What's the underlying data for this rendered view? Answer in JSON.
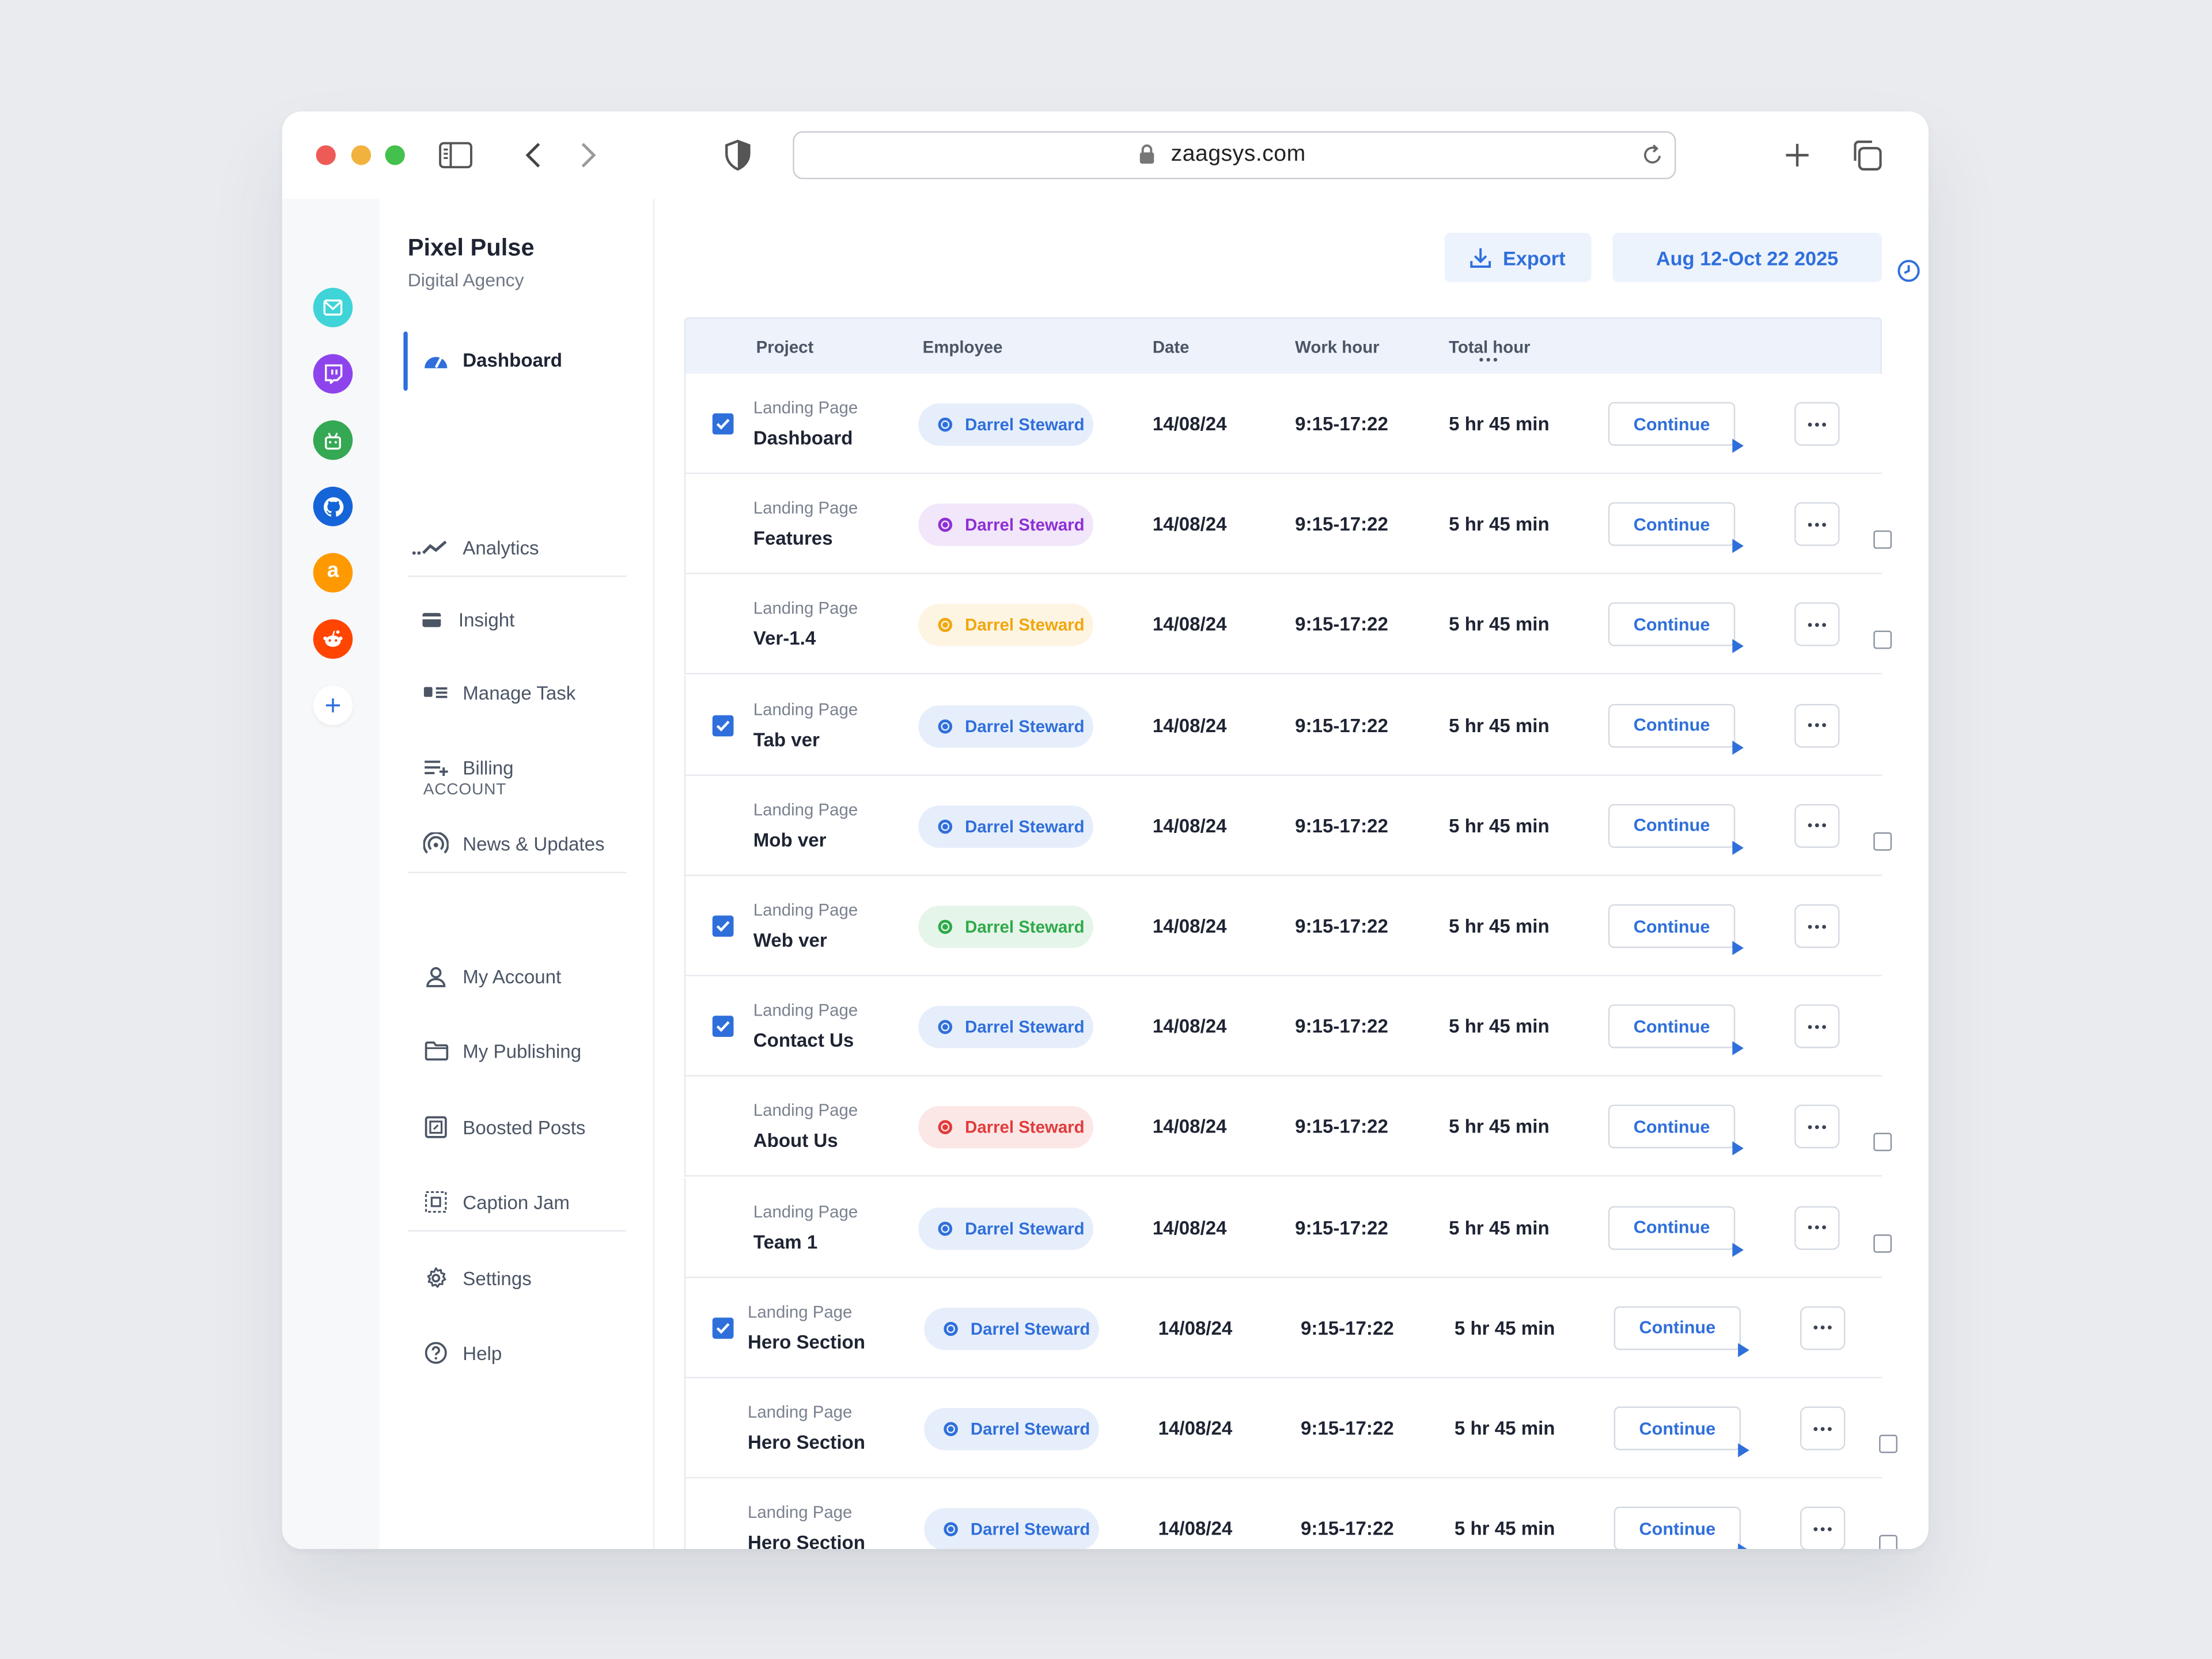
{
  "browser": {
    "url": "zaagsys.com"
  },
  "brand": {
    "name": "Pixel Pulse",
    "subtitle": "Digital Agency"
  },
  "nav": [
    {
      "label": "Dashboard",
      "icon": "dashboard-gauge-icon",
      "active": true
    },
    {
      "label": "Analytics",
      "icon": "analytics-line-icon"
    },
    {
      "label": "Insight",
      "icon": "card-icon"
    },
    {
      "label": "Manage Task",
      "icon": "task-list-icon"
    },
    {
      "label": "Billing",
      "icon": "billing-list-add-icon"
    },
    {
      "label": "News & Updates",
      "icon": "broadcast-icon"
    }
  ],
  "account_section": "ACCOUNT",
  "account_nav": [
    {
      "label": "My Account",
      "icon": "user-icon"
    },
    {
      "label": "My Publishing",
      "icon": "folder-icon"
    },
    {
      "label": "Boosted Posts",
      "icon": "boost-icon"
    },
    {
      "label": "Caption Jam",
      "icon": "caption-frame-icon"
    },
    {
      "label": "Settings",
      "icon": "gear-icon"
    },
    {
      "label": "Help",
      "icon": "help-circle-icon"
    }
  ],
  "rail_apps": [
    {
      "name": "mail-app-icon",
      "color": "#3fd4d8"
    },
    {
      "name": "twitch-icon",
      "color": "#8e44ec"
    },
    {
      "name": "android-icon",
      "color": "#34a853"
    },
    {
      "name": "github-icon",
      "color": "#1565d8"
    },
    {
      "name": "amazon-icon",
      "color": "#ff9900",
      "glyph": "a"
    },
    {
      "name": "reddit-icon",
      "color": "#ff4500"
    }
  ],
  "toolbar": {
    "export_label": "Export",
    "date_range": "Aug 12-Oct 22 2025"
  },
  "table": {
    "headers": {
      "project": "Project",
      "employee": "Employee",
      "date": "Date",
      "work_hour": "Work hour",
      "total_hour": "Total hour"
    },
    "rows": [
      {
        "subtitle": "Landing Page",
        "title": "Dashboard",
        "employee": "Darrel Steward",
        "status_color": "#2f6fdb",
        "date": "14/08/24",
        "work_hour": "9:15-17:22",
        "total": "5 hr 45 min",
        "action": "Continue",
        "checked": true
      },
      {
        "subtitle": "Landing Page",
        "title": "Features",
        "employee": "Darrel Steward",
        "status_color": "#8e2fd6",
        "date": "14/08/24",
        "work_hour": "9:15-17:22",
        "total": "5 hr 45 min",
        "action": "Continue",
        "checked": false
      },
      {
        "subtitle": "Landing Page",
        "title": "Ver-1.4",
        "employee": "Darrel Steward",
        "status_color": "#f0a70e",
        "date": "14/08/24",
        "work_hour": "9:15-17:22",
        "total": "5 hr 45 min",
        "action": "Continue",
        "checked": false
      },
      {
        "subtitle": "Landing Page",
        "title": "Tab ver",
        "employee": "Darrel Steward",
        "status_color": "#2f6fdb",
        "date": "14/08/24",
        "work_hour": "9:15-17:22",
        "total": "5 hr 45 min",
        "action": "Continue",
        "checked": true
      },
      {
        "subtitle": "Landing Page",
        "title": "Mob ver",
        "employee": "Darrel Steward",
        "status_color": "#2f6fdb",
        "date": "14/08/24",
        "work_hour": "9:15-17:22",
        "total": "5 hr 45 min",
        "action": "Continue",
        "checked": false
      },
      {
        "subtitle": "Landing Page",
        "title": "Web ver",
        "employee": "Darrel Steward",
        "status_color": "#2eaa4a",
        "date": "14/08/24",
        "work_hour": "9:15-17:22",
        "total": "5 hr 45 min",
        "action": "Continue",
        "checked": true
      },
      {
        "subtitle": "Landing Page",
        "title": "Contact Us",
        "employee": "Darrel Steward",
        "status_color": "#2f6fdb",
        "date": "14/08/24",
        "work_hour": "9:15-17:22",
        "total": "5 hr 45 min",
        "action": "Continue",
        "checked": true
      },
      {
        "subtitle": "Landing Page",
        "title": "About Us",
        "employee": "Darrel Steward",
        "status_color": "#e23b3b",
        "date": "14/08/24",
        "work_hour": "9:15-17:22",
        "total": "5 hr 45 min",
        "action": "Continue",
        "checked": false
      },
      {
        "subtitle": "Landing Page",
        "title": "Team 1",
        "employee": "Darrel Steward",
        "status_color": "#2f6fdb",
        "date": "14/08/24",
        "work_hour": "9:15-17:22",
        "total": "5 hr 45 min",
        "action": "Continue",
        "checked": false
      },
      {
        "subtitle": "Landing Page",
        "title": "Hero Section",
        "employee": "Darrel Steward",
        "status_color": "#2f6fdb",
        "date": "14/08/24",
        "work_hour": "9:15-17:22",
        "total": "5 hr 45 min",
        "action": "Continue",
        "checked": true
      },
      {
        "subtitle": "Landing Page",
        "title": "Hero Section",
        "employee": "Darrel Steward",
        "status_color": "#2f6fdb",
        "date": "14/08/24",
        "work_hour": "9:15-17:22",
        "total": "5 hr 45 min",
        "action": "Continue",
        "checked": false
      },
      {
        "subtitle": "Landing Page",
        "title": "Hero Section",
        "employee": "Darrel Steward",
        "status_color": "#2f6fdb",
        "date": "14/08/24",
        "work_hour": "9:15-17:22",
        "total": "5 hr 45 min",
        "action": "Continue",
        "checked": false
      }
    ]
  }
}
